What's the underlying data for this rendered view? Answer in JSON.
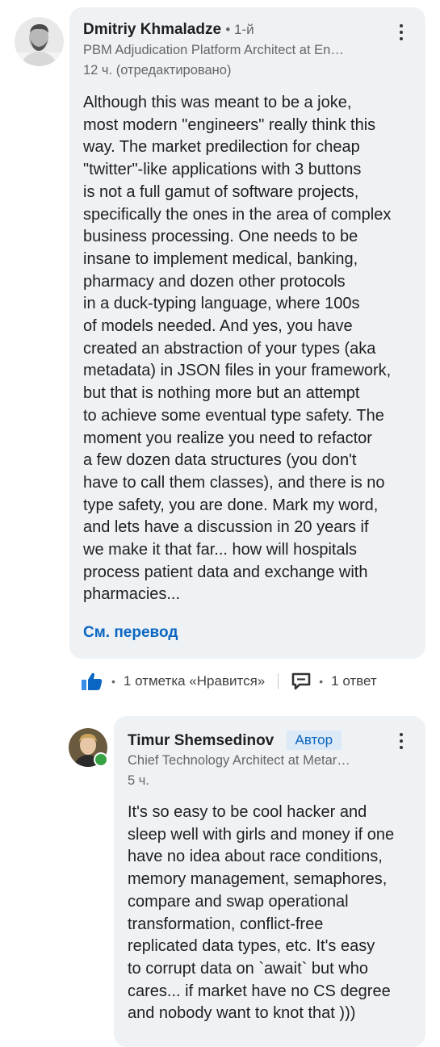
{
  "comment1": {
    "author": "Dmitriy Khmaladze",
    "degree": "• 1-й",
    "headline": "PBM Adjudication Platform Architect at En…",
    "time": "12 ч. (отредактировано)",
    "body_lines": [
      "Although this was meant to be a joke,",
      "most modern \"engineers\" really think this",
      "way. The market predilection for cheap",
      "\"twitter\"-like applications with 3 buttons",
      "is not a full gamut of software projects,",
      "specifically the ones in the area of complex",
      "business processing. One needs to be",
      "insane to implement medical, banking,",
      "pharmacy and dozen other protocols",
      "in a duck-typing language, where 100s",
      "of models needed. And yes, you have",
      "created an abstraction of your types (aka",
      "metadata) in JSON files in your framework,",
      "but that is nothing more but an attempt",
      "to achieve some eventual type safety. The",
      "moment you realize you need to refactor",
      "a few dozen data structures (you don't",
      "have to call them classes), and there is no",
      "type safety, you are done. Mark my word,",
      "and lets have a discussion in 20 years if",
      "we make it that far... how will hospitals",
      "process patient data and exchange with",
      "pharmacies..."
    ],
    "translate_label": "См. перевод",
    "likes_text": "1 отметка «Нравится»",
    "replies_text": "1 ответ"
  },
  "reply1": {
    "author": "Timur Shemsedinov",
    "badge": "Автор",
    "headline": "Chief Technology Architect at Metar…",
    "time": "5 ч.",
    "body_lines": [
      "It's so easy to be cool hacker and",
      "sleep well with girls and money if one",
      "have no idea about race conditions,",
      "memory management, semaphores,",
      "compare and swap operational",
      "transformation, conflict-free",
      "replicated data types, etc. It's easy",
      "to corrupt data on `await` but who",
      "cares... if market have no CS degree",
      "and nobody want to knot that )))"
    ]
  },
  "colors": {
    "bubble": "#eef2f5",
    "link": "#0a66c2",
    "badge_bg": "#dce9f6",
    "online": "#37a243"
  },
  "icons": [
    "more-vertical-icon",
    "thumbs-up-icon",
    "comment-icon",
    "online-status-icon"
  ]
}
